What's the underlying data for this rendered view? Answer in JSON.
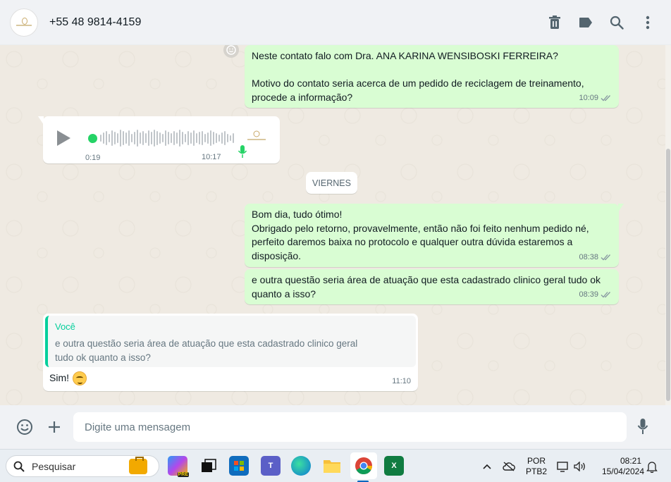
{
  "header": {
    "contact_name": "+55 48 9814-4159",
    "actions": [
      "delete-icon",
      "label-icon",
      "search-icon",
      "more-vertical-icon"
    ]
  },
  "messages": [
    {
      "direction": "outgoing",
      "lines": [
        "Neste contato falo com Dra. ANA KARINA WENSIBOSKI FERREIRA?",
        "",
        "Motivo do contato seria acerca de um pedido de reciclagem de treinamento,",
        "procede a informação?"
      ],
      "time": "10:09",
      "status": "read"
    },
    {
      "direction": "incoming",
      "type": "voice",
      "duration": "0:19",
      "time": "10:17",
      "progress": 0.0
    },
    {
      "direction": "outgoing",
      "lines": [
        "Bom dia, tudo ótimo!",
        "Obrigado pelo retorno, provavelmente,  então não foi feito nenhum pedido né,",
        "perfeito daremos baixa no protocolo e qualquer outra dúvida estaremos a",
        "disposição."
      ],
      "time": "08:38",
      "status": "read"
    },
    {
      "direction": "outgoing",
      "lines": [
        "e outra questão seria área de atuação que esta cadastrado clinico geral tudo ok",
        "quanto a isso?"
      ],
      "time": "08:39",
      "status": "read"
    },
    {
      "direction": "incoming",
      "quote": {
        "author": "Você",
        "lines": [
          "e outra questão seria área de atuação que esta cadastrado clinico geral",
          "tudo ok quanto a isso?"
        ]
      },
      "text": "Sim!",
      "emoji": "smirking-face",
      "time": "11:10"
    }
  ],
  "day_separator": "VIERNES",
  "composer": {
    "placeholder": "Digite uma mensagem"
  },
  "taskbar": {
    "search_label": "Pesquisar",
    "language_top": "POR",
    "language_bottom": "PTB2",
    "clock_time": "08:21",
    "clock_date": "15/04/2024",
    "apps": [
      "copilot",
      "task-view",
      "microsoft-store",
      "teams",
      "edge",
      "file-explorer",
      "chrome",
      "excel"
    ]
  },
  "colors": {
    "outgoing_bubble": "#d9fdd3",
    "incoming_bubble": "#ffffff",
    "accent_green": "#25d366",
    "quote_accent": "#06cf9c",
    "chat_background": "#efeae2"
  }
}
